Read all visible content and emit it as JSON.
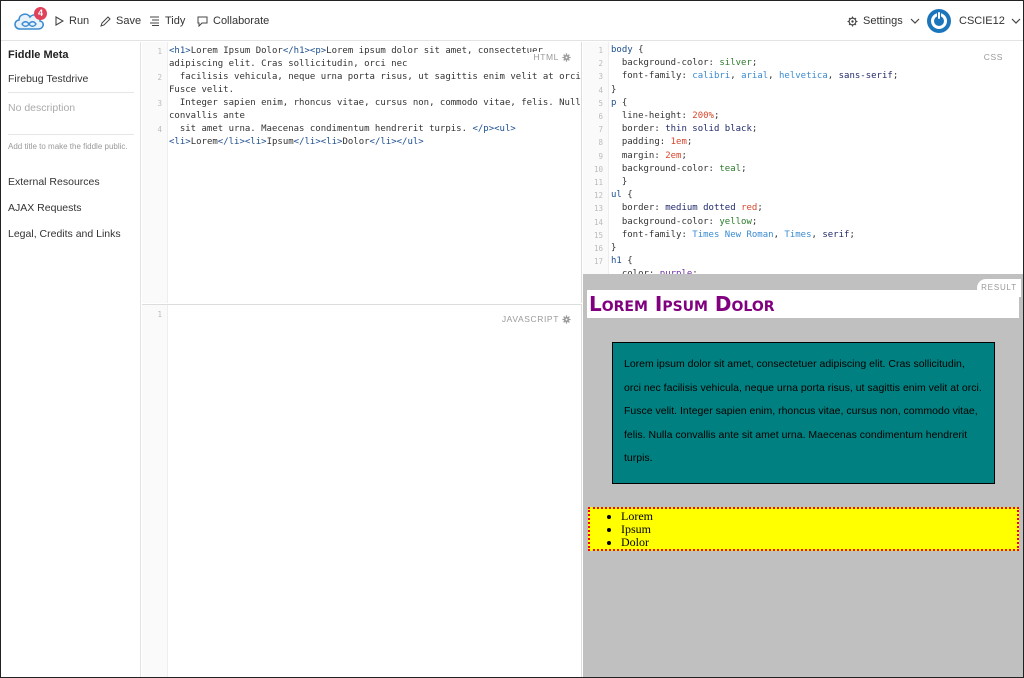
{
  "toolbar": {
    "notification_count": "4",
    "run_label": "Run",
    "save_label": "Save",
    "tidy_label": "Tidy",
    "collaborate_label": "Collaborate",
    "settings_label": "Settings",
    "account_name": "CSCIE12"
  },
  "sidebar": {
    "title": "Fiddle Meta",
    "fiddle_name": "Firebug Testdrive",
    "description_placeholder": "No description",
    "hint": "Add title to make the fiddle public.",
    "links": [
      "External Resources",
      "AJAX Requests",
      "Legal, Credits and Links"
    ]
  },
  "panels": {
    "html_label": "HTML",
    "css_label": "CSS",
    "js_label": "JAVASCRIPT",
    "result_label": "RESULT"
  },
  "html_code": {
    "line_numbers": [
      "1",
      "2",
      "3",
      "4"
    ]
  },
  "css_code": {
    "line_numbers": [
      "1",
      "2",
      "3",
      "4",
      "5",
      "6",
      "7",
      "8",
      "9",
      "10",
      "11",
      "12",
      "13",
      "14",
      "15",
      "16",
      "17"
    ]
  },
  "js_code": {
    "line_numbers": [
      "1"
    ]
  },
  "result": {
    "heading": "Lorem Ipsum Dolor",
    "paragraph": "Lorem ipsum dolor sit amet, consectetuer adipiscing elit. Cras sollicitudin, orci nec facilisis vehicula, neque urna porta risus, ut sagittis enim velit at orci. Fusce velit. Integer sapien enim, rhoncus vitae, cursus non, commodo vitae, felis. Nulla convallis ante sit amet urna. Maecenas condimentum hendrerit turpis.",
    "list_items": [
      "Lorem",
      "Ipsum",
      "Dolor"
    ]
  },
  "colors": {
    "accent": "#1b75bb",
    "badge": "#e0425b",
    "result_bg": "#c0c0c0",
    "heading": "#800080",
    "paragraph_bg": "#008080",
    "list_bg": "#ffff00",
    "list_border": "#ff0000"
  },
  "icons": [
    "jsfiddle-logo-icon",
    "play-icon",
    "pencil-icon",
    "tidy-lines-icon",
    "chat-icon",
    "gear-icon",
    "chevron-down-icon",
    "power-icon"
  ]
}
